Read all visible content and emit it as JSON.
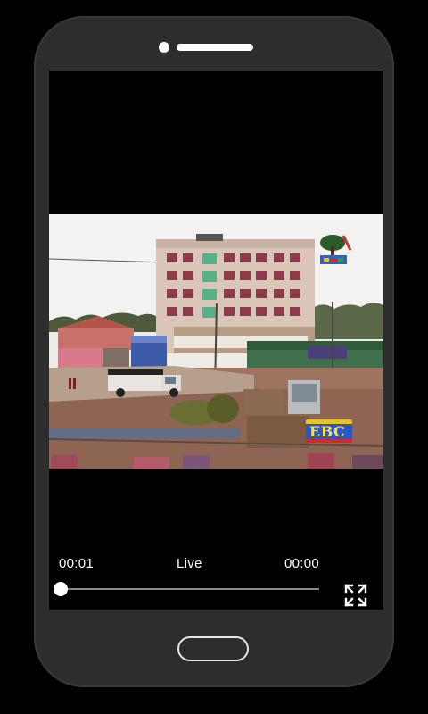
{
  "player": {
    "current_time": "00:01",
    "status": "Live",
    "duration": "00:00",
    "progress": 0.0
  },
  "icons": {
    "fullscreen": "fullscreen-expand-icon",
    "channel_logo": "ebc-channel-logo",
    "watermark": "ebc-tree-watermark"
  },
  "logo_text": "EBC",
  "colors": {
    "background": "#000000",
    "phone_body": "#2d2d2d",
    "control_text": "#ffffff",
    "seek_track": "#8a8a8a"
  }
}
